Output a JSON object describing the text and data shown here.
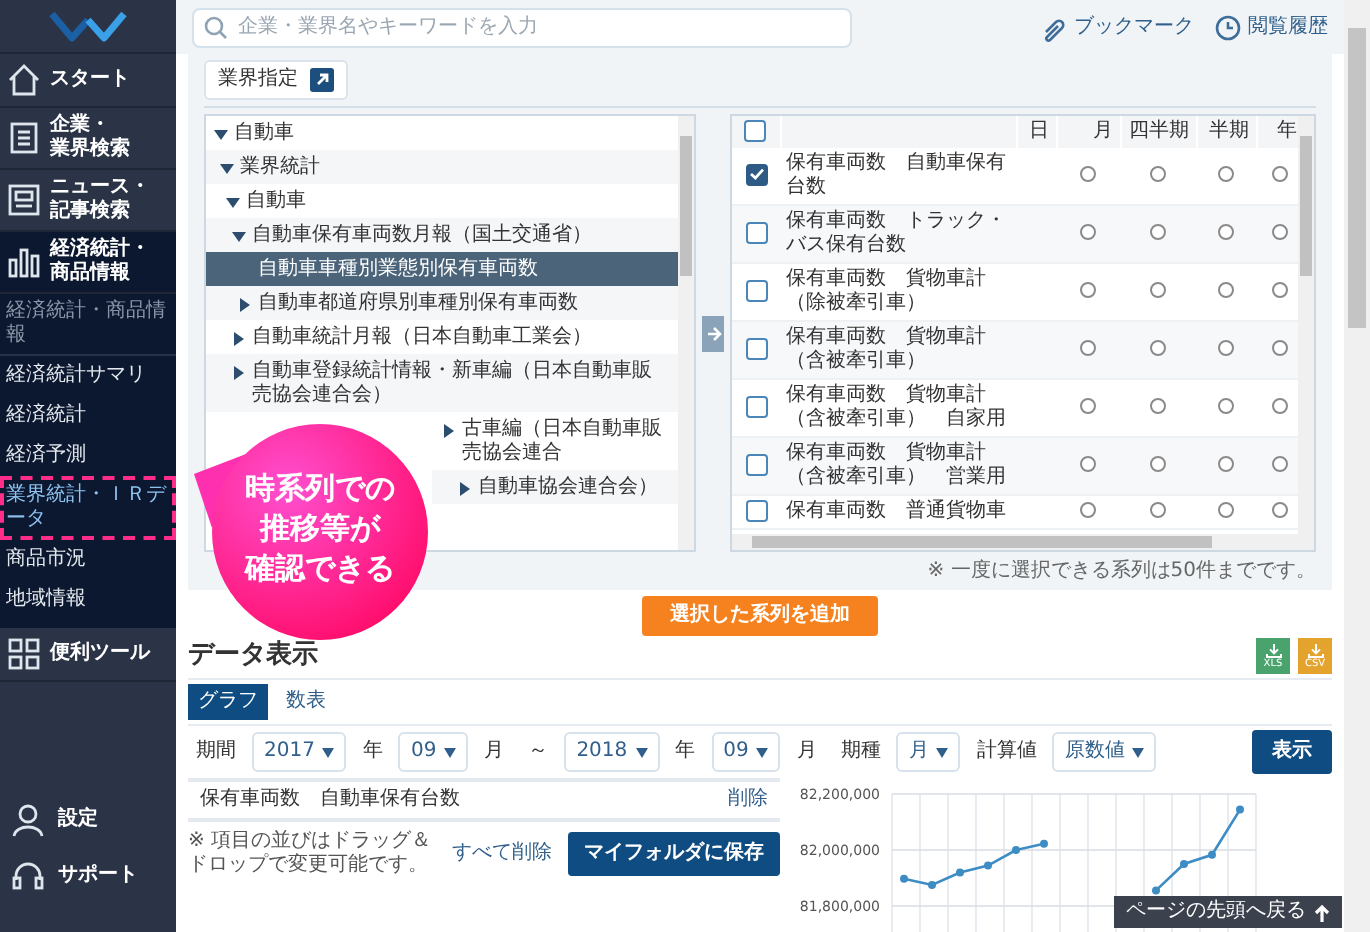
{
  "sidebar": {
    "items": [
      {
        "kind": "nav",
        "lines": [
          "スタート"
        ],
        "selected": false
      },
      {
        "kind": "nav",
        "lines": [
          "企業・",
          "業界検索"
        ],
        "selected": false
      },
      {
        "kind": "nav",
        "lines": [
          "ニュース・",
          "記事検索"
        ],
        "selected": false
      },
      {
        "kind": "nav",
        "lines": [
          "経済統計・",
          "商品情報"
        ],
        "selected": true
      },
      {
        "kind": "heading",
        "text": "経済統計・商品情報"
      },
      {
        "kind": "sub",
        "text": "経済統計サマリ",
        "selected": false
      },
      {
        "kind": "sub",
        "text": "経済統計",
        "selected": false
      },
      {
        "kind": "sub",
        "text": "経済予測",
        "selected": false
      },
      {
        "kind": "sub",
        "text": "業界統計・ＩＲデータ",
        "selected": true
      },
      {
        "kind": "sub",
        "text": "商品市況",
        "selected": false
      },
      {
        "kind": "sub",
        "text": "地域情報",
        "selected": false
      },
      {
        "kind": "nav",
        "lines": [
          "便利ツール"
        ],
        "selected": false
      }
    ],
    "footer": [
      {
        "label": "設定"
      },
      {
        "label": "サポート"
      }
    ]
  },
  "search": {
    "placeholder": "企業・業界名やキーワードを入力"
  },
  "header_links": [
    {
      "label": "ブックマーク"
    },
    {
      "label": "閲覧履歴"
    }
  ],
  "industry_button": "業界指定",
  "tree": [
    {
      "label": "自動車",
      "expanded": true,
      "selected": false,
      "children": [
        {
          "label": "業界統計",
          "expanded": true,
          "selected": false,
          "children": [
            {
              "label": "自動車",
              "expanded": true,
              "selected": false,
              "children": [
                {
                  "label": "自動車保有車両数月報（国土交通省）",
                  "expanded": true,
                  "selected": false,
                  "children": [
                    {
                      "label": "自動車車種別業態別保有車両数",
                      "selected": true
                    },
                    {
                      "label": "自動車都道府県別車種別保有車両数",
                      "expanded": false,
                      "selected": false
                    }
                  ]
                },
                {
                  "label": "自動車統計月報（日本自動車工業会）",
                  "expanded": false,
                  "selected": false
                },
                {
                  "label": "自動車登録統計情報・新車編（日本自動車販売協会連合会）",
                  "expanded": false,
                  "selected": false
                },
                {
                  "label": "古車編（日本自動車販売協会連合",
                  "expanded": false,
                  "selected": false
                },
                {
                  "label": "自動車協会連合会）",
                  "expanded": false,
                  "selected": false
                }
              ]
            }
          ]
        }
      ]
    }
  ],
  "series_table": {
    "header_checked": false,
    "columns": [
      "日",
      "月",
      "四半期",
      "半期",
      "年"
    ],
    "rows": [
      {
        "name": "保有車両数　自動車保有台数",
        "checked": true,
        "radios": [
          {
            "selected": false
          },
          {
            "selected": false
          },
          {
            "selected": false
          },
          {
            "selected": false
          }
        ]
      },
      {
        "name": "保有車両数　トラック・バス保有台数",
        "checked": false,
        "radios": [
          {
            "selected": false
          },
          {
            "selected": false
          },
          {
            "selected": false
          },
          {
            "selected": false
          }
        ]
      },
      {
        "name": "保有車両数　貨物車計（除被牽引車）",
        "checked": false,
        "radios": [
          {
            "selected": false
          },
          {
            "selected": false
          },
          {
            "selected": false
          },
          {
            "selected": false
          }
        ]
      },
      {
        "name": "保有車両数　貨物車計（含被牽引車）",
        "checked": false,
        "radios": [
          {
            "selected": false
          },
          {
            "selected": false
          },
          {
            "selected": false
          },
          {
            "selected": false
          }
        ]
      },
      {
        "name": "保有車両数　貨物車計（含被牽引車）　自家用",
        "checked": false,
        "radios": [
          {
            "selected": false
          },
          {
            "selected": false
          },
          {
            "selected": false
          },
          {
            "selected": false
          }
        ]
      },
      {
        "name": "保有車両数　貨物車計（含被牽引車）　営業用",
        "checked": false,
        "radios": [
          {
            "selected": false
          },
          {
            "selected": false
          },
          {
            "selected": false
          },
          {
            "selected": false
          }
        ]
      },
      {
        "name": "保有車両数　普通貨物車",
        "checked": false,
        "radios": [
          {
            "selected": false
          },
          {
            "selected": false
          },
          {
            "selected": false
          },
          {
            "selected": false
          }
        ]
      }
    ]
  },
  "selection_note": "※ 一度に選択できる系列は50件までです。",
  "add_button": "選択した系列を追加",
  "callout": {
    "lines": [
      "時系列での",
      "推移等が",
      "確認できる"
    ]
  },
  "data_view": {
    "title": "データ表示",
    "downloads": [
      {
        "label": "XLS",
        "color": "#4aa36c"
      },
      {
        "label": "CSV",
        "color": "#e3a32c"
      }
    ],
    "tabs": [
      {
        "label": "グラフ",
        "selected": true
      },
      {
        "label": "数表",
        "selected": false
      }
    ],
    "filters": [
      {
        "kind": "label",
        "text": "期間"
      },
      {
        "kind": "select",
        "value": "2017"
      },
      {
        "kind": "label",
        "text": "年"
      },
      {
        "kind": "select",
        "value": "09"
      },
      {
        "kind": "label",
        "text": "月"
      },
      {
        "kind": "label",
        "text": "～"
      },
      {
        "kind": "select",
        "value": "2018"
      },
      {
        "kind": "label",
        "text": "年"
      },
      {
        "kind": "select",
        "value": "09"
      },
      {
        "kind": "label",
        "text": "月"
      },
      {
        "kind": "label",
        "text": "期種"
      },
      {
        "kind": "select",
        "value": "月"
      },
      {
        "kind": "label",
        "text": "計算値"
      },
      {
        "kind": "select",
        "value": "原数値"
      }
    ],
    "show_button": "表示",
    "series": [
      {
        "name": "保有車両数　自動車保有台数",
        "action": "削除"
      }
    ],
    "hint": "※ 項目の並びはドラッグ＆ドロップで変更可能です。",
    "clear_all": "すべて削除",
    "save_button": "マイフォルダに保存",
    "chart_data": {
      "type": "line",
      "ylim": [
        81600000,
        82200000
      ],
      "grid": true,
      "yticks": [
        {
          "value": 82200000,
          "label": "82,200,000"
        },
        {
          "value": 82000000,
          "label": "82,000,000"
        },
        {
          "value": 81800000,
          "label": "81,800,000"
        }
      ],
      "series": [
        {
          "color": "#3d8cc4",
          "marker": true,
          "values": [
            81897000,
            81875000,
            81919000,
            81944000,
            82000000,
            82022000,
            null,
            null,
            null,
            81856000,
            81950000,
            81983000,
            82144000
          ]
        }
      ]
    }
  },
  "back_to_top": "ページの先頭へ戻る"
}
